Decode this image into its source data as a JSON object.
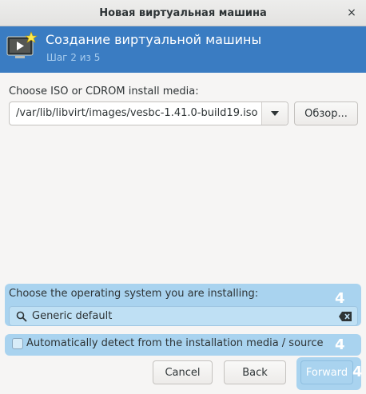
{
  "window": {
    "title": "Новая виртуальная машина",
    "close_glyph": "×"
  },
  "banner": {
    "heading": "Создание виртуальной машины",
    "step": "Шаг 2 из 5",
    "icon": "monitor-star-icon"
  },
  "install_media": {
    "label": "Choose ISO or CDROM install media:",
    "selected_path": "/var/lib/libvirt/images/vesbc-1.41.0-build19.iso",
    "browse_label": "Обзор..."
  },
  "os": {
    "label": "Choose the operating system you are installing:",
    "search_value": "Generic default",
    "auto_detect_label": "Automatically detect from the installation media / source",
    "auto_detect_checked": false
  },
  "badges": {
    "os_section": "4",
    "auto_detect": "4",
    "forward": "4"
  },
  "buttons": {
    "cancel": "Cancel",
    "back": "Back",
    "forward": "Forward"
  },
  "colors": {
    "banner": "#3a7cc2",
    "highlight": "#a9d3ef"
  }
}
